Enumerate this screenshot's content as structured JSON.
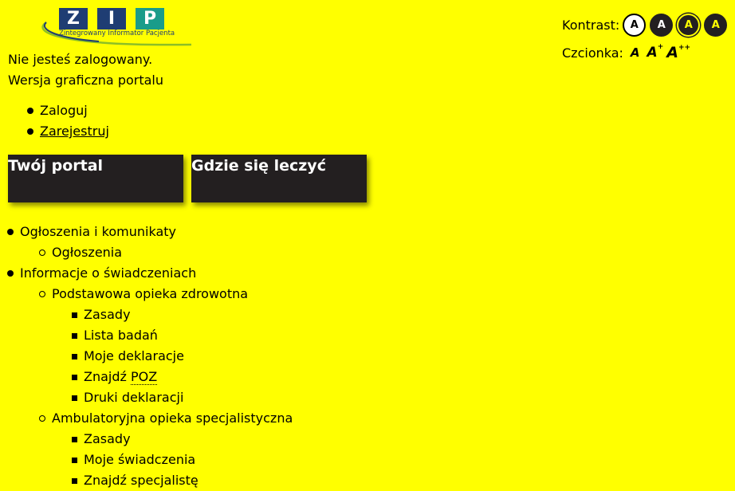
{
  "logo": {
    "letters": [
      "Z",
      "I",
      "P"
    ],
    "subtitle": "Zintegrowany Informator Pacjenta",
    "colors": {
      "navy": "#1f3d73",
      "teal": "#1a9c8a",
      "swoosh": "#8cbf26"
    }
  },
  "status": {
    "login_state": "Nie jesteś zalogowany.",
    "version": "Wersja graficzna portalu"
  },
  "auth_links": [
    "Zaloguj",
    "Zarejestruj"
  ],
  "portal_boxes": [
    "Twój portal",
    "Gdzie się leczyć"
  ],
  "nav": {
    "announcements": {
      "label": "Ogłoszenia i komunikaty",
      "items": [
        "Ogłoszenia"
      ]
    },
    "services": {
      "label": "Informacje o świadczeniach",
      "poz": {
        "label": "Podstawowa opieka zdrowotna",
        "items": [
          "Zasady",
          "Lista badań",
          "Moje deklaracje"
        ],
        "find_prefix": "Znajdź ",
        "find_abbr": "POZ",
        "print_forms": "Druki deklaracji"
      },
      "aos": {
        "label": "Ambulatoryjna opieka specjalistyczna",
        "items": [
          "Zasady",
          "Moje świadczenia",
          "Znajdź specjalistę"
        ]
      }
    }
  },
  "controls": {
    "contrast_label": "Kontrast:",
    "contrast_options": [
      "A",
      "A",
      "A",
      "A"
    ],
    "font_label": "Czcionka:",
    "font_base": "A",
    "font_plus": "+",
    "font_plusplus": "++"
  },
  "colors": {
    "background": "#ffff00",
    "dark_box": "#231f20"
  }
}
